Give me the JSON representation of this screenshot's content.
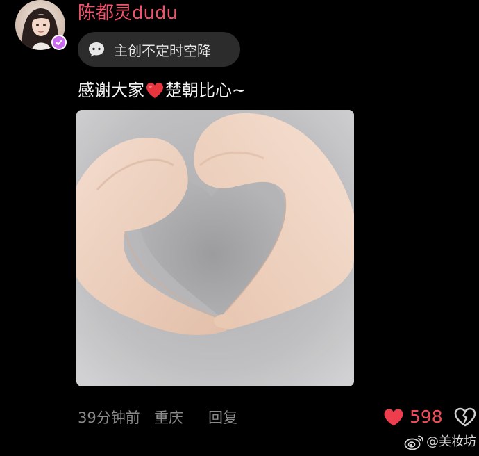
{
  "author": {
    "name": "陈都灵dudu",
    "verified": true,
    "name_color": "#f0546c",
    "badge_color": "#c96cf0"
  },
  "tag": {
    "icon": "chat-bubble-icon",
    "label": "主创不定时空降"
  },
  "post": {
    "text_before": "感谢大家",
    "emoji": "red-heart-emoji",
    "text_after": "楚朝比心~",
    "image_description_icon": "heart-hands-photo"
  },
  "meta": {
    "time": "39分钟前",
    "location": "重庆",
    "reply_label": "回复"
  },
  "reactions": {
    "like_icon": "heart-icon",
    "like_count": "598",
    "like_color": "#ee4a58",
    "dislike_icon": "broken-heart-icon"
  },
  "watermark": {
    "icon": "weibo-icon",
    "text": "@美妆坊"
  }
}
